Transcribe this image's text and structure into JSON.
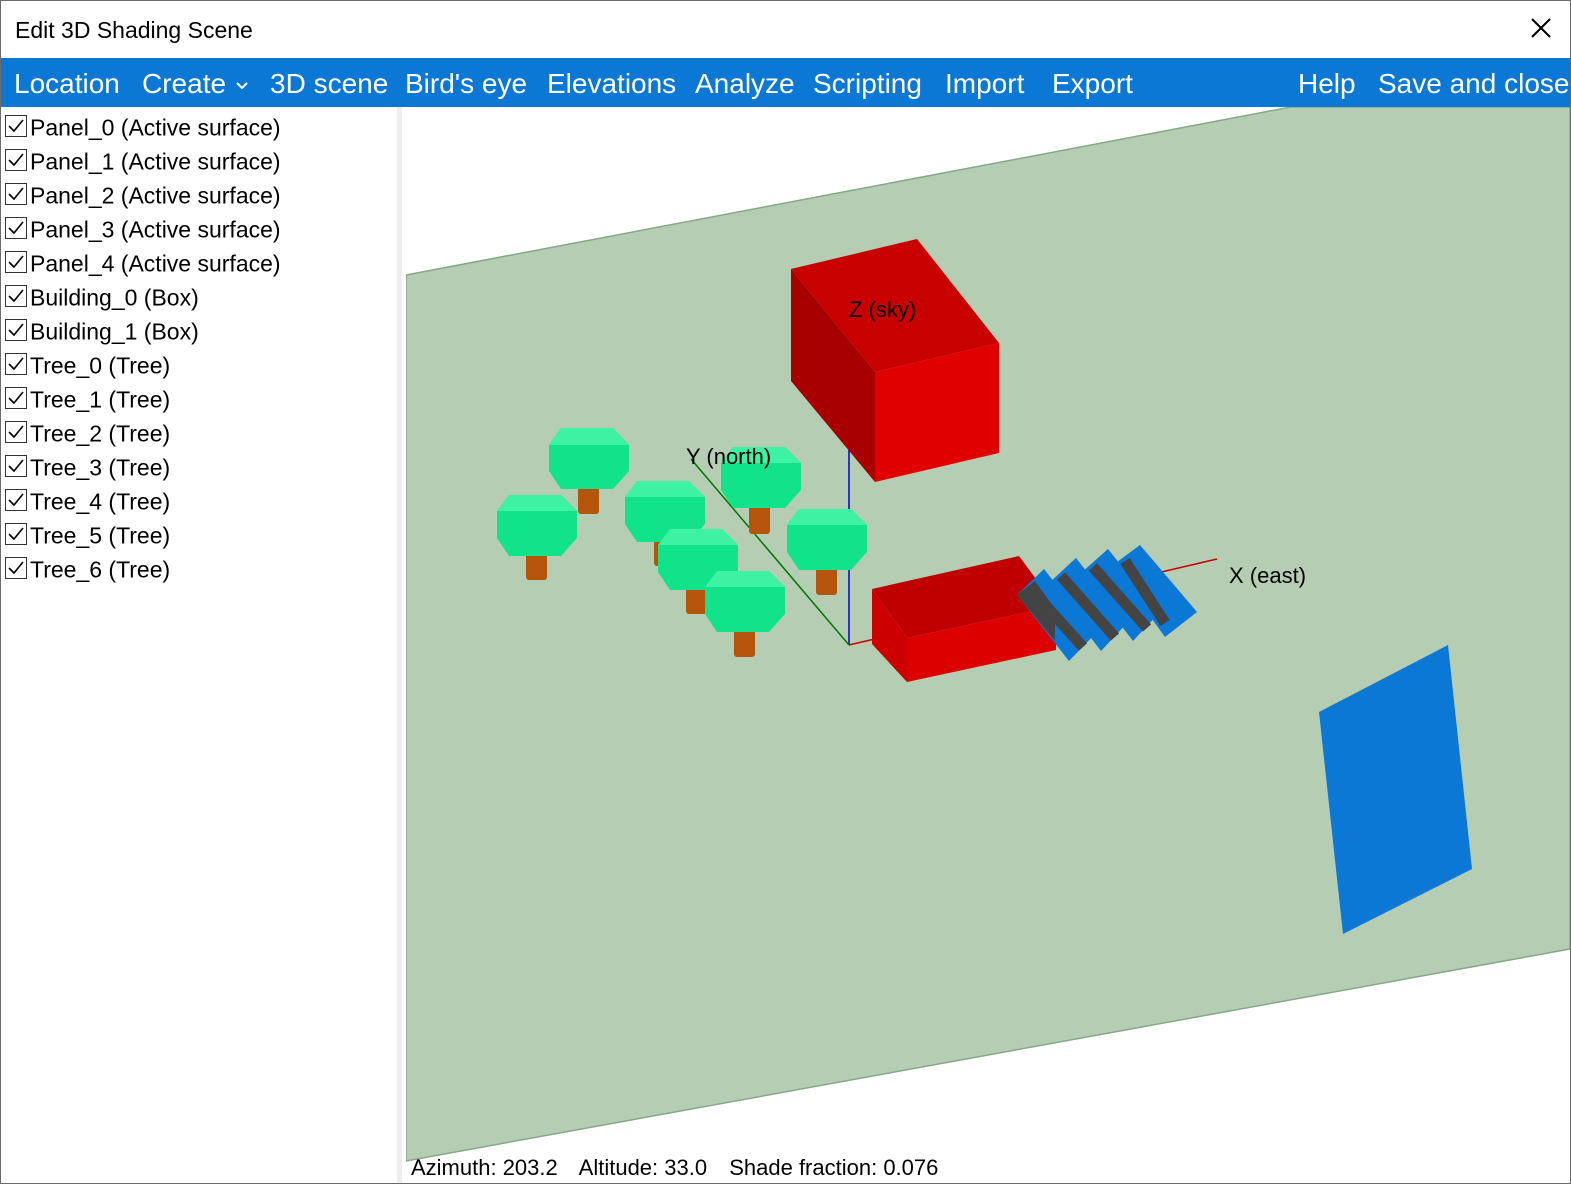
{
  "window": {
    "title": "Edit 3D Shading Scene"
  },
  "menu": {
    "items": [
      "Location",
      "Create",
      "3D scene",
      "Bird's eye",
      "Elevations",
      "Analyze",
      "Scripting",
      "Import",
      "Export"
    ],
    "right_items": [
      "Help",
      "Save and close"
    ]
  },
  "objects": [
    {
      "label": "Panel_0 (Active surface)",
      "checked": true
    },
    {
      "label": "Panel_1 (Active surface)",
      "checked": true
    },
    {
      "label": "Panel_2 (Active surface)",
      "checked": true
    },
    {
      "label": "Panel_3 (Active surface)",
      "checked": true
    },
    {
      "label": "Panel_4 (Active surface)",
      "checked": true
    },
    {
      "label": "Building_0 (Box)",
      "checked": true
    },
    {
      "label": "Building_1 (Box)",
      "checked": true
    },
    {
      "label": "Tree_0 (Tree)",
      "checked": true
    },
    {
      "label": "Tree_1 (Tree)",
      "checked": true
    },
    {
      "label": "Tree_2 (Tree)",
      "checked": true
    },
    {
      "label": "Tree_3 (Tree)",
      "checked": true
    },
    {
      "label": "Tree_4 (Tree)",
      "checked": true
    },
    {
      "label": "Tree_5 (Tree)",
      "checked": true
    },
    {
      "label": "Tree_6 (Tree)",
      "checked": true
    }
  ],
  "axes": {
    "z_label": "Z (sky)",
    "y_label": "Y (north)",
    "x_label": "X (east)"
  },
  "status": {
    "azimuth": "Azimuth: 203.2",
    "altitude": "Altitude: 33.0",
    "shade_fraction": "Shade fraction: 0.076"
  },
  "colors": {
    "menu_bar": "#0a78d4",
    "ground": "#b5cdb2",
    "building": "#cc0000",
    "panel": "#0a78d4",
    "tree_canopy": "#11e38a",
    "tree_trunk": "#b5540b"
  }
}
